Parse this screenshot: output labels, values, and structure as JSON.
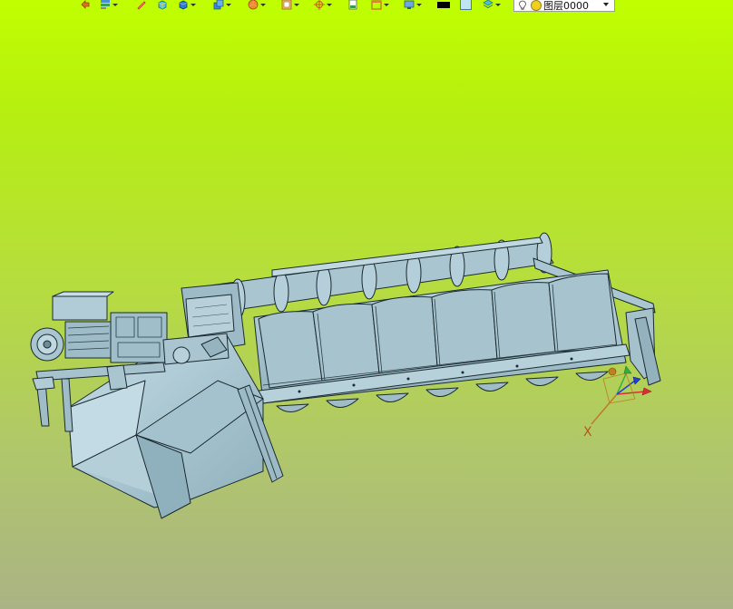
{
  "toolbar": {
    "items": [
      {
        "icon": "undo-view-icon"
      },
      {
        "icon": "view-list-icon",
        "dropdown": true
      },
      {
        "icon": "pencil-icon"
      },
      {
        "icon": "box-cyan-icon"
      },
      {
        "icon": "box-blue-icon",
        "dropdown": true
      },
      {
        "icon": "box-stack-icon",
        "dropdown": true
      },
      {
        "icon": "pie-render-icon",
        "dropdown": true
      },
      {
        "icon": "section-box-icon",
        "dropdown": true
      },
      {
        "icon": "target-cross-icon",
        "dropdown": true
      },
      {
        "icon": "page-icon"
      },
      {
        "icon": "frame-icon",
        "dropdown": true
      },
      {
        "icon": "monitor-icon",
        "dropdown": true
      },
      {
        "icon": "black-color-swatch"
      },
      {
        "icon": "light-blue-color-swatch"
      },
      {
        "icon": "layers-icon",
        "dropdown": true
      }
    ],
    "layer_select": {
      "value": "图层0000"
    }
  },
  "viewport": {
    "background_top": "#c0ff00",
    "background_bottom": "#aab385",
    "model_color": "#a9c8d4",
    "axis_label_x": "X"
  }
}
